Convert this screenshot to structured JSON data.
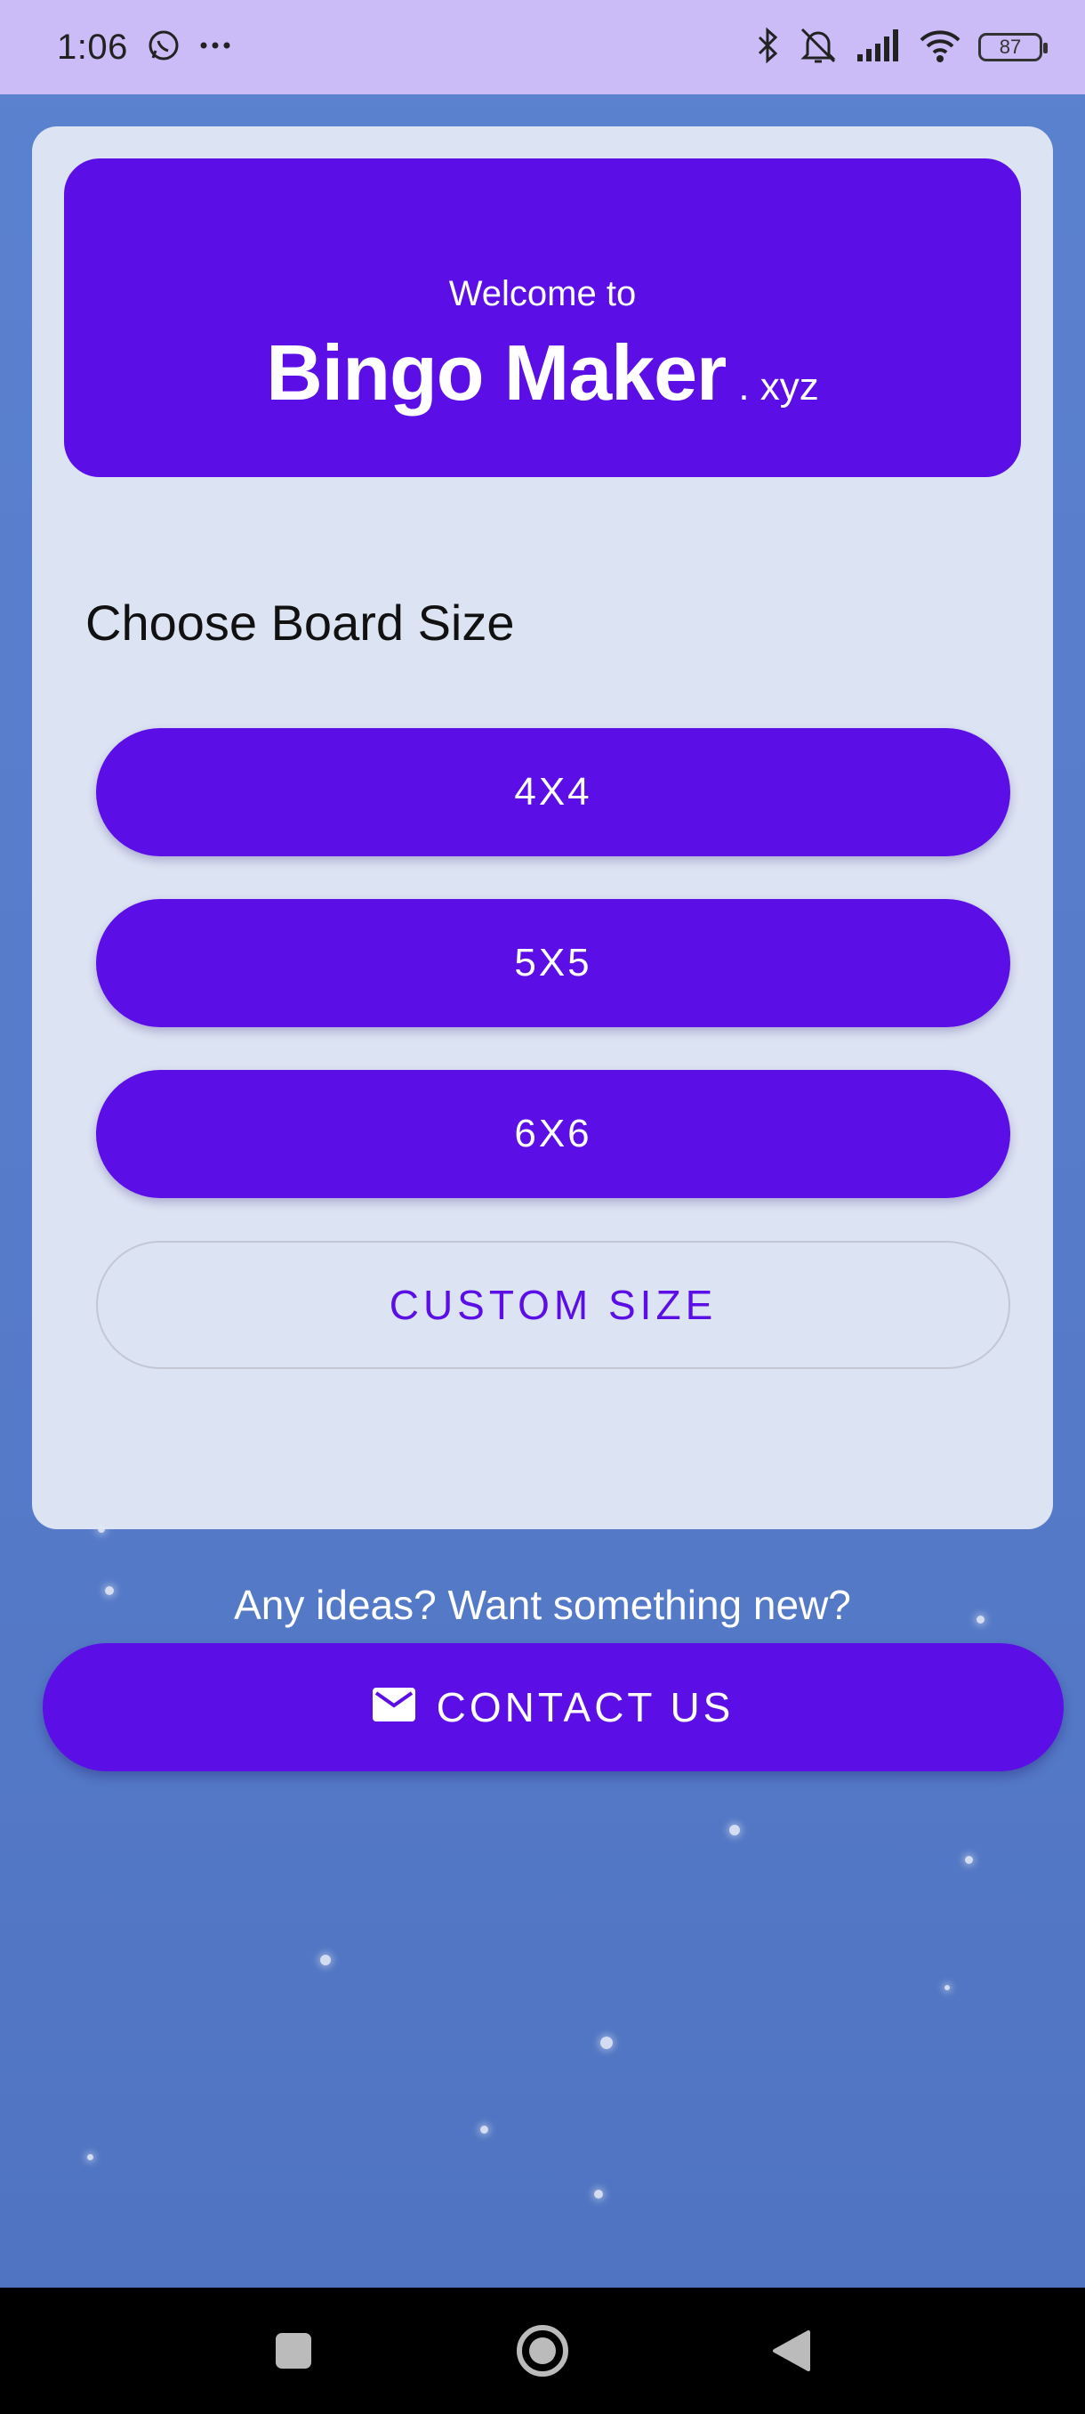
{
  "status_bar": {
    "time": "1:06",
    "battery": "87",
    "icons": [
      "whatsapp-icon",
      "more-dots-icon",
      "bluetooth-icon",
      "mute-bell-icon",
      "signal-icon",
      "wifi-icon",
      "battery-icon"
    ]
  },
  "hero": {
    "welcome": "Welcome to",
    "title": "Bingo Maker",
    "suffix": ". xyz"
  },
  "board": {
    "title": "Choose Board Size",
    "options": [
      "4X4",
      "5X5",
      "6X6"
    ],
    "custom_label": "CUSTOM SIZE"
  },
  "contact": {
    "prompt": "Any ideas? Want something new?",
    "button_label": "CONTACT US",
    "icon": "mail-icon"
  },
  "nav": {
    "icons": [
      "recent-apps-icon",
      "home-icon",
      "back-icon"
    ]
  },
  "colors": {
    "accent": "#5b0ee6",
    "status_bar": "#cbbcf7",
    "background": "#5b82cf",
    "card": "#e2e7f4"
  }
}
